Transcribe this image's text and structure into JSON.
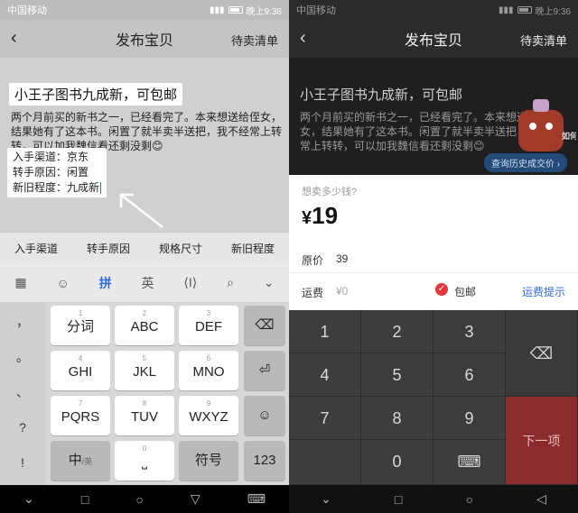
{
  "status": {
    "carrier": "中国移动",
    "time": "晚上9:36"
  },
  "header": {
    "title": "发布宝贝",
    "right_link": "待卖清单",
    "back_icon": "‹"
  },
  "post": {
    "title": "小王子图书九成新，可包邮",
    "description": "两个月前买的新书之一，已经看完了。本来想送给侄女，结果她有了这本书。闲置了就半卖半送把，我不经常上转转，可以加我魏信看还剩没剩😊",
    "details": [
      "入手渠道：京东",
      "转手原因：闲置",
      "新旧程度：九成新"
    ]
  },
  "tags": [
    "入手渠道",
    "转手原因",
    "规格尺寸",
    "新旧程度"
  ],
  "keyboard": {
    "toolbar": [
      "拼",
      "英"
    ],
    "side_keys": [
      "，",
      "。",
      "、",
      "?",
      "!"
    ],
    "keys": [
      {
        "top": "1",
        "label": "分词"
      },
      {
        "top": "2",
        "label": "ABC"
      },
      {
        "top": "3",
        "label": "DEF"
      },
      {
        "top": "4",
        "label": "GHI"
      },
      {
        "top": "5",
        "label": "JKL"
      },
      {
        "top": "6",
        "label": "MNO"
      },
      {
        "top": "7",
        "label": "PQRS"
      },
      {
        "top": "8",
        "label": "TUV"
      },
      {
        "top": "9",
        "label": "WXYZ"
      }
    ],
    "bottom": {
      "zh": "中",
      "en_small": "/英",
      "space_top": "0",
      "symbol": "符号",
      "numbers": "123"
    }
  },
  "right": {
    "mascot_text": "如何定价?",
    "history_button": "查询历史成交价 ›",
    "price_question": "想卖多少钱?",
    "price_value": "19",
    "currency": "¥",
    "orig_label": "原价",
    "orig_value": "39",
    "ship_label": "运费",
    "ship_value": "¥0",
    "free_shipping": "包邮",
    "ship_tip": "运费提示",
    "numpad": [
      "1",
      "2",
      "3",
      "4",
      "5",
      "6",
      "7",
      "8",
      "9",
      "0"
    ],
    "next_label": "下一项"
  },
  "colors": {
    "accent_blue": "#2f6de0",
    "check_red": "#e3383c",
    "next_red": "#8c2b2b"
  }
}
